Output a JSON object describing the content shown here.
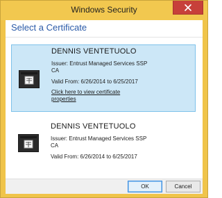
{
  "window": {
    "title": "Windows Security"
  },
  "dialog": {
    "header": "Select a Certificate"
  },
  "certificates": [
    {
      "name": "DENNIS VENTETUOLO",
      "issuer_line1": "Issuer: Entrust Managed Services SSP",
      "issuer_line2": "CA",
      "valid": "Valid From: 6/26/2014 to 6/25/2017",
      "link_line1": "Click here to view certificate",
      "link_line2": "properties",
      "selected": true
    },
    {
      "name": "DENNIS VENTETUOLO",
      "issuer_line1": "Issuer: Entrust Managed Services SSP",
      "issuer_line2": "CA",
      "valid": "Valid From: 6/26/2014 to 6/25/2017",
      "selected": false
    }
  ],
  "buttons": {
    "ok": "OK",
    "cancel": "Cancel"
  },
  "icons": {
    "close": "close-icon",
    "certificate": "certificate-icon"
  },
  "colors": {
    "titlebar": "#f2c84f",
    "close_button": "#c7403a",
    "header_text": "#2a5aa8",
    "selection_fill": "#cce7f7",
    "selection_border": "#7ec2ea"
  }
}
